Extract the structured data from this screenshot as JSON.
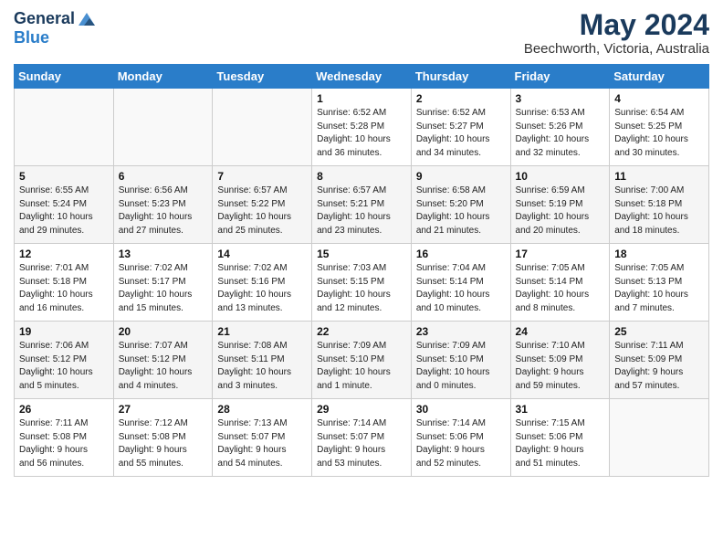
{
  "logo": {
    "line1": "General",
    "line2": "Blue"
  },
  "title": "May 2024",
  "subtitle": "Beechworth, Victoria, Australia",
  "weekdays": [
    "Sunday",
    "Monday",
    "Tuesday",
    "Wednesday",
    "Thursday",
    "Friday",
    "Saturday"
  ],
  "weeks": [
    [
      {
        "day": "",
        "info": ""
      },
      {
        "day": "",
        "info": ""
      },
      {
        "day": "",
        "info": ""
      },
      {
        "day": "1",
        "info": "Sunrise: 6:52 AM\nSunset: 5:28 PM\nDaylight: 10 hours\nand 36 minutes."
      },
      {
        "day": "2",
        "info": "Sunrise: 6:52 AM\nSunset: 5:27 PM\nDaylight: 10 hours\nand 34 minutes."
      },
      {
        "day": "3",
        "info": "Sunrise: 6:53 AM\nSunset: 5:26 PM\nDaylight: 10 hours\nand 32 minutes."
      },
      {
        "day": "4",
        "info": "Sunrise: 6:54 AM\nSunset: 5:25 PM\nDaylight: 10 hours\nand 30 minutes."
      }
    ],
    [
      {
        "day": "5",
        "info": "Sunrise: 6:55 AM\nSunset: 5:24 PM\nDaylight: 10 hours\nand 29 minutes."
      },
      {
        "day": "6",
        "info": "Sunrise: 6:56 AM\nSunset: 5:23 PM\nDaylight: 10 hours\nand 27 minutes."
      },
      {
        "day": "7",
        "info": "Sunrise: 6:57 AM\nSunset: 5:22 PM\nDaylight: 10 hours\nand 25 minutes."
      },
      {
        "day": "8",
        "info": "Sunrise: 6:57 AM\nSunset: 5:21 PM\nDaylight: 10 hours\nand 23 minutes."
      },
      {
        "day": "9",
        "info": "Sunrise: 6:58 AM\nSunset: 5:20 PM\nDaylight: 10 hours\nand 21 minutes."
      },
      {
        "day": "10",
        "info": "Sunrise: 6:59 AM\nSunset: 5:19 PM\nDaylight: 10 hours\nand 20 minutes."
      },
      {
        "day": "11",
        "info": "Sunrise: 7:00 AM\nSunset: 5:18 PM\nDaylight: 10 hours\nand 18 minutes."
      }
    ],
    [
      {
        "day": "12",
        "info": "Sunrise: 7:01 AM\nSunset: 5:18 PM\nDaylight: 10 hours\nand 16 minutes."
      },
      {
        "day": "13",
        "info": "Sunrise: 7:02 AM\nSunset: 5:17 PM\nDaylight: 10 hours\nand 15 minutes."
      },
      {
        "day": "14",
        "info": "Sunrise: 7:02 AM\nSunset: 5:16 PM\nDaylight: 10 hours\nand 13 minutes."
      },
      {
        "day": "15",
        "info": "Sunrise: 7:03 AM\nSunset: 5:15 PM\nDaylight: 10 hours\nand 12 minutes."
      },
      {
        "day": "16",
        "info": "Sunrise: 7:04 AM\nSunset: 5:14 PM\nDaylight: 10 hours\nand 10 minutes."
      },
      {
        "day": "17",
        "info": "Sunrise: 7:05 AM\nSunset: 5:14 PM\nDaylight: 10 hours\nand 8 minutes."
      },
      {
        "day": "18",
        "info": "Sunrise: 7:05 AM\nSunset: 5:13 PM\nDaylight: 10 hours\nand 7 minutes."
      }
    ],
    [
      {
        "day": "19",
        "info": "Sunrise: 7:06 AM\nSunset: 5:12 PM\nDaylight: 10 hours\nand 5 minutes."
      },
      {
        "day": "20",
        "info": "Sunrise: 7:07 AM\nSunset: 5:12 PM\nDaylight: 10 hours\nand 4 minutes."
      },
      {
        "day": "21",
        "info": "Sunrise: 7:08 AM\nSunset: 5:11 PM\nDaylight: 10 hours\nand 3 minutes."
      },
      {
        "day": "22",
        "info": "Sunrise: 7:09 AM\nSunset: 5:10 PM\nDaylight: 10 hours\nand 1 minute."
      },
      {
        "day": "23",
        "info": "Sunrise: 7:09 AM\nSunset: 5:10 PM\nDaylight: 10 hours\nand 0 minutes."
      },
      {
        "day": "24",
        "info": "Sunrise: 7:10 AM\nSunset: 5:09 PM\nDaylight: 9 hours\nand 59 minutes."
      },
      {
        "day": "25",
        "info": "Sunrise: 7:11 AM\nSunset: 5:09 PM\nDaylight: 9 hours\nand 57 minutes."
      }
    ],
    [
      {
        "day": "26",
        "info": "Sunrise: 7:11 AM\nSunset: 5:08 PM\nDaylight: 9 hours\nand 56 minutes."
      },
      {
        "day": "27",
        "info": "Sunrise: 7:12 AM\nSunset: 5:08 PM\nDaylight: 9 hours\nand 55 minutes."
      },
      {
        "day": "28",
        "info": "Sunrise: 7:13 AM\nSunset: 5:07 PM\nDaylight: 9 hours\nand 54 minutes."
      },
      {
        "day": "29",
        "info": "Sunrise: 7:14 AM\nSunset: 5:07 PM\nDaylight: 9 hours\nand 53 minutes."
      },
      {
        "day": "30",
        "info": "Sunrise: 7:14 AM\nSunset: 5:06 PM\nDaylight: 9 hours\nand 52 minutes."
      },
      {
        "day": "31",
        "info": "Sunrise: 7:15 AM\nSunset: 5:06 PM\nDaylight: 9 hours\nand 51 minutes."
      },
      {
        "day": "",
        "info": ""
      }
    ]
  ]
}
